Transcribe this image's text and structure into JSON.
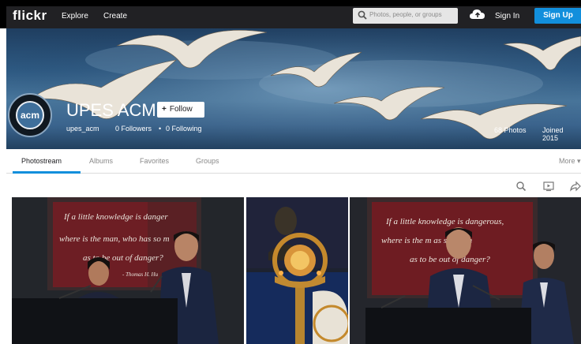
{
  "nav": {
    "logo": "flickr",
    "explore": "Explore",
    "create": "Create",
    "search_placeholder": "Photos, people, or groups",
    "sign_in": "Sign In",
    "sign_up": "Sign Up"
  },
  "profile": {
    "name": "UPES ACM",
    "avatar_text": "acm",
    "follow_label": "Follow",
    "username": "upes_acm",
    "followers": "0 Followers",
    "following": "0 Following",
    "separator": "•",
    "photos": "68 Photos",
    "joined": "Joined 2015"
  },
  "tabs": [
    "Photostream",
    "Albums",
    "Favorites",
    "Groups"
  ],
  "more_label": "More ▾",
  "icons": [
    "search-icon",
    "slideshow-icon",
    "share-icon"
  ],
  "photos": [
    {
      "quote_line1": "If a little knowledge is danger",
      "quote_line2": "where is the man, who has so m",
      "quote_line3": "as to be out of danger?",
      "attribution": "- Thomas H. Hu"
    },
    {
      "quote_line1": "",
      "quote_line2": "",
      "quote_line3": "",
      "attribution": ""
    },
    {
      "quote_line1": "If a little knowledge is dangerous,",
      "quote_line2": "where is the m      as so much",
      "quote_line3": "as to be out of danger?",
      "attribution": ""
    }
  ],
  "colors": {
    "accent": "#128fdc",
    "nav_bg": "#212124"
  }
}
